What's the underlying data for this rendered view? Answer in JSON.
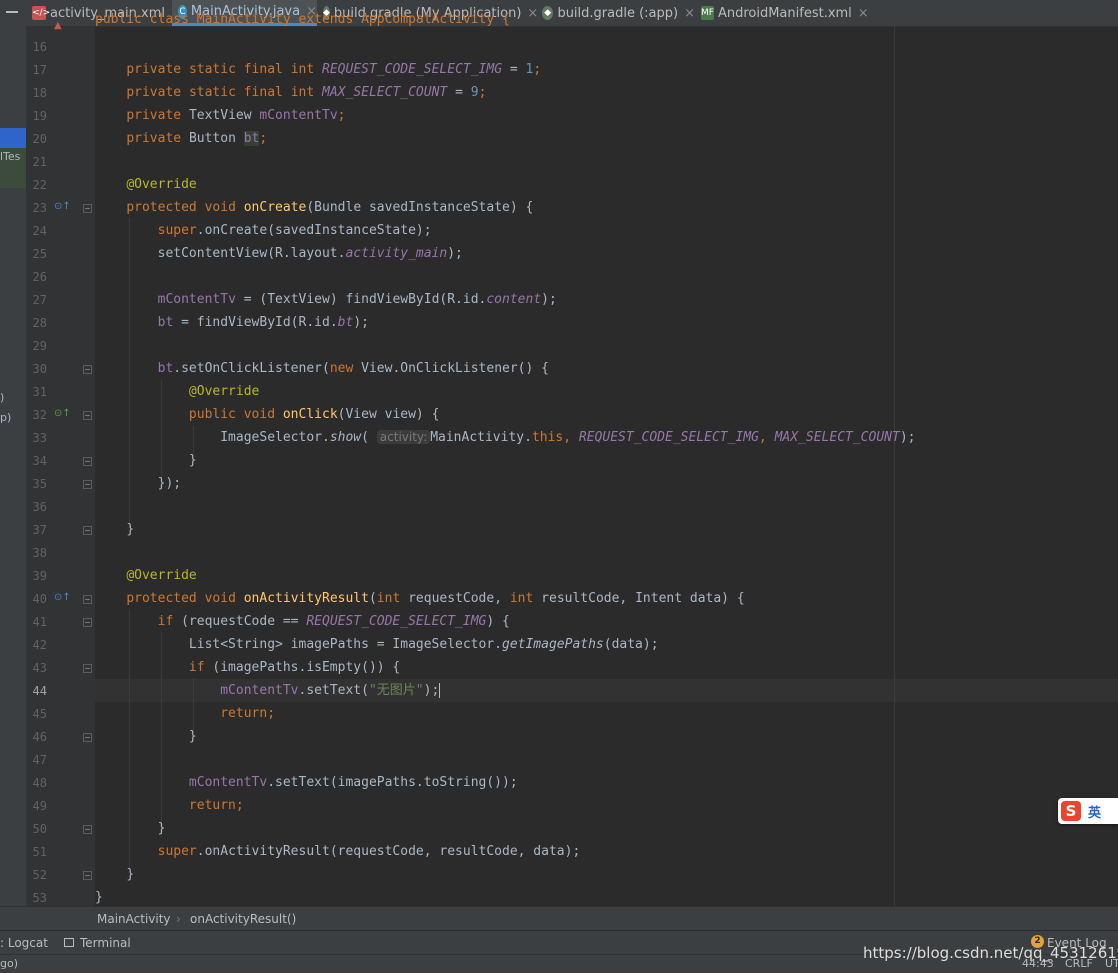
{
  "tabs": [
    {
      "label": "activity_main.xml",
      "icon": "xml-layout-icon"
    },
    {
      "label": "MainActivity.java",
      "icon": "java-class-icon",
      "active": true
    },
    {
      "label": "build.gradle (My Application)",
      "icon": "gradle-icon"
    },
    {
      "label": "build.gradle (:app)",
      "icon": "gradle-icon"
    },
    {
      "label": "AndroidManifest.xml",
      "icon": "manifest-icon"
    }
  ],
  "close_glyph": "×",
  "left_strip": {
    "text1": "lTes",
    "text2": ")",
    "text3": "p)",
    "text4": "go)"
  },
  "line_numbers": [
    "16",
    "17",
    "18",
    "19",
    "20",
    "21",
    "22",
    "23",
    "24",
    "25",
    "26",
    "27",
    "28",
    "29",
    "30",
    "31",
    "32",
    "33",
    "34",
    "35",
    "36",
    "37",
    "38",
    "39",
    "40",
    "41",
    "42",
    "43",
    "44",
    "45",
    "46",
    "47",
    "48",
    "49",
    "50",
    "51",
    "52",
    "53"
  ],
  "current_line": "44",
  "code": {
    "l15": "public class MainActivity extends AppCompatActivity {",
    "private": "private",
    "static": "static",
    "final": "final",
    "int": "int",
    "req_name": "REQUEST_CODE_SELECT_IMG",
    "eq1": " = ",
    "req_val": "1",
    "semi": ";",
    "max_name": "MAX_SELECT_COUNT",
    "max_val": "9",
    "textview": "TextView",
    "mcontent": "mContentTv",
    "button": "Button",
    "bt": "bt",
    "override": "@Override",
    "protected": "protected",
    "void": "void",
    "oncreate": "onCreate",
    "oncreate_params": "(Bundle savedInstanceState) {",
    "super": "super",
    "super_oncreate": ".onCreate(savedInstanceState);",
    "setcontent": "setContentView(R.layout.",
    "activity_main": "activity_main",
    "close_paren_semi": ");",
    "l27_a": " = (TextView) findViewById(R.id.",
    "content": "content",
    "l28_a": " = findViewById(R.id.",
    "l30_a": ".setOnClickListener(",
    "new": "new",
    "l30_b": " View.OnClickListener() {",
    "public": "public",
    "onclick": "onClick",
    "onclick_params": "(View view) {",
    "imageselector": "ImageSelector.",
    "show": "show",
    "open_paren": "(",
    "hint": "activity:",
    "mainactivity": "MainActivity.",
    "this": "this",
    "comma": ", ",
    "l33_end": ");",
    "rbrace": "}",
    "l35": "});",
    "onactivityresult": "onActivityResult",
    "oar_params_a": "(",
    "oar_p1": " requestCode, ",
    "oar_p2": " resultCode, Intent data) {",
    "if": "if",
    "l41_a": " (requestCode == ",
    "l41_b": ") {",
    "l42_a": "List<String> imagePaths = ImageSelector.",
    "getimagepaths": "getImagePaths",
    "l42_b": "(data);",
    "l43": " (imagePaths.isEmpty()) {",
    "settext_a": ".setText(",
    "str_noimg": "\"无图片\"",
    "return": "return",
    "l48_b": ".setText(imagePaths.toString());",
    "super_oar": ".onActivityResult(requestCode, resultCode, data);"
  },
  "breadcrumb": {
    "item1": "MainActivity",
    "sep": "›",
    "item2": "onActivityResult()"
  },
  "bottom_tools": {
    "logcat": ": Logcat",
    "terminal": "Terminal",
    "event_log": "Event Log",
    "event_count": "2"
  },
  "status": {
    "position": "44:43",
    "line_sep": "CRLF",
    "encoding": "UT"
  },
  "watermark": "https://blog.csdn.net/qq_45312619",
  "ime": {
    "logo": "S",
    "lang": "英"
  },
  "colors": {
    "keyword": "#cc7832",
    "field": "#9876aa",
    "number": "#6897bb",
    "annotation": "#bbb529",
    "method": "#ffc66d",
    "string": "#6a8759",
    "text": "#a9b7c6",
    "background": "#2b2b2b"
  }
}
